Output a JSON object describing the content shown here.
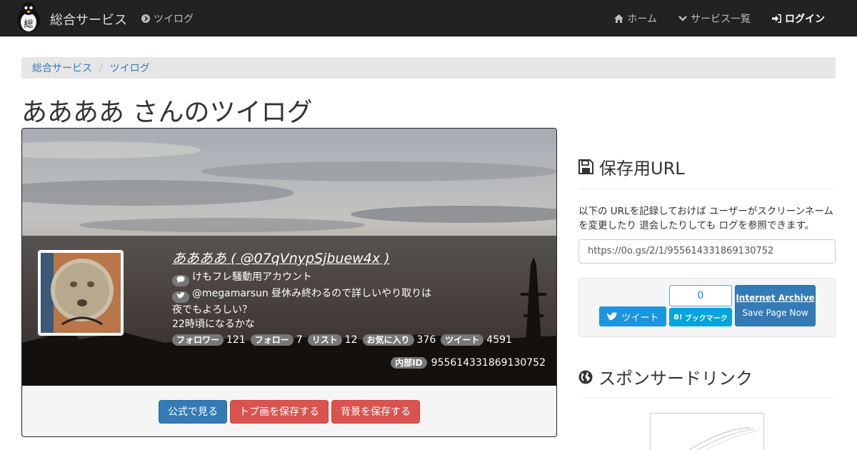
{
  "navbar": {
    "brand": "総合サービス",
    "left_item": "ツイログ",
    "right_items": [
      "ホーム",
      "サービス一覧",
      "ログイン"
    ],
    "logo_char": "総"
  },
  "breadcrumb": [
    "総合サービス",
    "ツイログ"
  ],
  "page_title": "ああああ さんのツイログ",
  "profile": {
    "name": "ああああ ( @07qVnypSjbuew4x )",
    "bio": "けもフレ騒動用アカウント",
    "tweet_line1": "@megamarsun 昼休み終わるので詳しいやり取りは",
    "tweet_line2": "夜でもよろしい？",
    "tweet_line3": "22時頃になるかな",
    "stats": [
      {
        "label": "フォロワー",
        "value": "121"
      },
      {
        "label": "フォロー",
        "value": "7"
      },
      {
        "label": "リスト",
        "value": "12"
      },
      {
        "label": "お気に入り",
        "value": "376"
      },
      {
        "label": "ツイート",
        "value": "4591"
      }
    ],
    "internal_id_label": "内部ID",
    "internal_id": "955614331869130752"
  },
  "buttons": {
    "official": "公式で見る",
    "save_icon": "トプ画を保存する",
    "save_bg": "背景を保存する"
  },
  "sidebar": {
    "save_heading": "保存用URL",
    "save_desc": "以下の URLを記録しておけば ユーザーがスクリーンネームを変更したり 退会したりしても ログを参照できます。",
    "save_url": "https://0o.gs/2/1/955614331869130752",
    "tweet_label": "ツイート",
    "hatena_count": "0",
    "hatena_label": "ブックマーク",
    "hatena_b": "B!",
    "ia_title": "Internet Archive",
    "ia_sub": "Save Page Now",
    "sponsor_heading": "スポンサードリンク"
  },
  "colors": {
    "navbar": "#222222",
    "link": "#337ab7",
    "danger": "#d9534f",
    "twitter": "#1b95e0",
    "hatena": "#00a4de"
  }
}
